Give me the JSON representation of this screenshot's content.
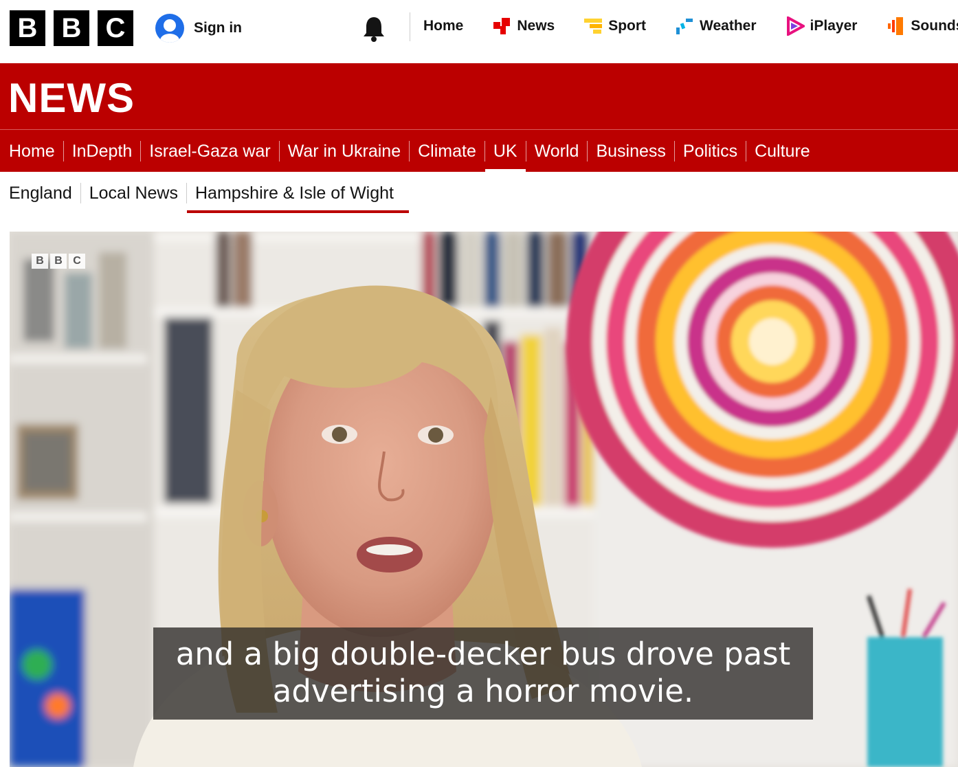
{
  "topbar": {
    "logo_letters": [
      "B",
      "B",
      "C"
    ],
    "sign_in": "Sign in",
    "links": [
      {
        "label": "Home",
        "icon": "none"
      },
      {
        "label": "News",
        "icon": "news-icon",
        "color": "#e60000"
      },
      {
        "label": "Sport",
        "icon": "sport-icon",
        "color": "#ffd230"
      },
      {
        "label": "Weather",
        "icon": "weather-icon",
        "color": "#1e90d6"
      },
      {
        "label": "iPlayer",
        "icon": "iplayer-icon",
        "color": "#e8117f"
      },
      {
        "label": "Sounds",
        "icon": "sounds-icon",
        "color": "#ff6600"
      }
    ]
  },
  "news": {
    "title": "NEWS",
    "nav": [
      "Home",
      "InDepth",
      "Israel-Gaza war",
      "War in Ukraine",
      "Climate",
      "UK",
      "World",
      "Business",
      "Politics",
      "Culture"
    ],
    "active_nav": "UK",
    "subnav": [
      "England",
      "Local News",
      "Hampshire & Isle of Wight"
    ],
    "active_subnav": "Hampshire & Isle of Wight"
  },
  "video": {
    "watermark": [
      "B",
      "B",
      "C"
    ],
    "caption_line1": "and a big double-decker bus drove past",
    "caption_line2": "advertising a horror movie."
  },
  "colors": {
    "brand_red": "#bb0000",
    "signin_blue": "#1f6ee8"
  }
}
